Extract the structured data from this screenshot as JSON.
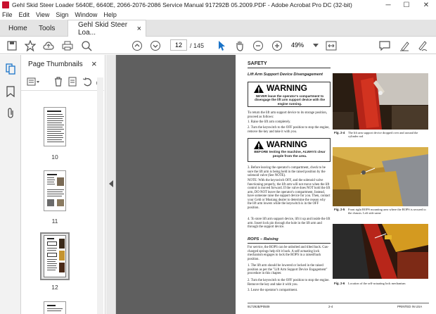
{
  "window": {
    "title": "Gehl Skid Steer Loader 5640E, 6640E, 2066-2076-2086 Service Manual 917292B 05.2009.PDF - Adobe Acrobat Pro DC (32-bit)",
    "minimize": "─",
    "maximize": "☐",
    "close": "✕"
  },
  "menu": [
    "File",
    "Edit",
    "View",
    "Sign",
    "Window",
    "Help"
  ],
  "tabs": {
    "home": "Home",
    "tools": "Tools",
    "document": "Gehl Skid Steer Loa...",
    "close": "×"
  },
  "toolbar": {
    "page_current": "12",
    "page_total": "/ 145",
    "zoom": "49%"
  },
  "panel": {
    "title": "Page Thumbnails",
    "close": "×",
    "thumbnails": [
      {
        "label": "10"
      },
      {
        "label": "11"
      },
      {
        "label": "12"
      }
    ]
  },
  "document": {
    "heading": "SAFETY",
    "section1": "Lift Arm Support Device Disengagement",
    "warning_word": "WARNING",
    "warning1_text": "NEVER leave the operator's compartment to disengage the lift arm support device with the engine running.",
    "intro": "To return the lift arm support device to its storage position, proceed as follows:",
    "steps_a": [
      "1. Raise the lift arm completely.",
      "2. Turn the keyswitch to the OFF position to stop the engine, remove the key and take it with you."
    ],
    "warning2_text": "BEFORE testing the machine, ALWAYS clear people from the area.",
    "step3": "3. Before leaving the operator's compartment, check to be sure the lift arm is being held in the raised position by the solenoid valve (See NOTE).",
    "note": "NOTE: With the keyswitch OFF, and the solenoid valve functioning properly, the lift arm will not move when the lift control is moved forward. If the valve does NOT hold the lift arm, DO NOT leave the operator's compartment. Instead, have someone raise the support device for you. Then, contact your Gehl or Mustang dealer to determine the reason why the lift arm lowers while the keyswitch is in the OFF position.",
    "step4": "4. To store lift arm support device, lift it up and inside the lift arm. Insert lock pin through the hole in the lift arm and through the support device.",
    "section2": "ROPS – Raising",
    "rops_intro": "For service, the ROPS can be unbolted and tilted back. Gas-charged springs help tilt it back. A self-actuating lock mechanism engages to lock the ROPS in a raised/back position.",
    "rops_steps": [
      "1. The lift arm should be lowered or locked in the raised position as per the \"Lift Arm Support Device Engagement\" procedure in this chapter.",
      "2. Turn the keyswitch to the OFF position to stop the engine. Remove the key and take it with you.",
      "3. Leave the operator's compartment."
    ],
    "fig1": "Fig. 2-4",
    "fig1_caption": "The lift arm support device dropped over and around the cylinder rod",
    "fig2": "Fig. 2-5",
    "fig2_caption": "Front right ROPS mounting area where the ROPS is secured to the chassis. Left side same",
    "fig3": "Fig. 2-6",
    "fig3_caption": "Location of the self-actuating lock mechanism",
    "footer_left": "917292B/P0509",
    "footer_mid": "2-4",
    "footer_right": "PRINTED IN USA"
  }
}
